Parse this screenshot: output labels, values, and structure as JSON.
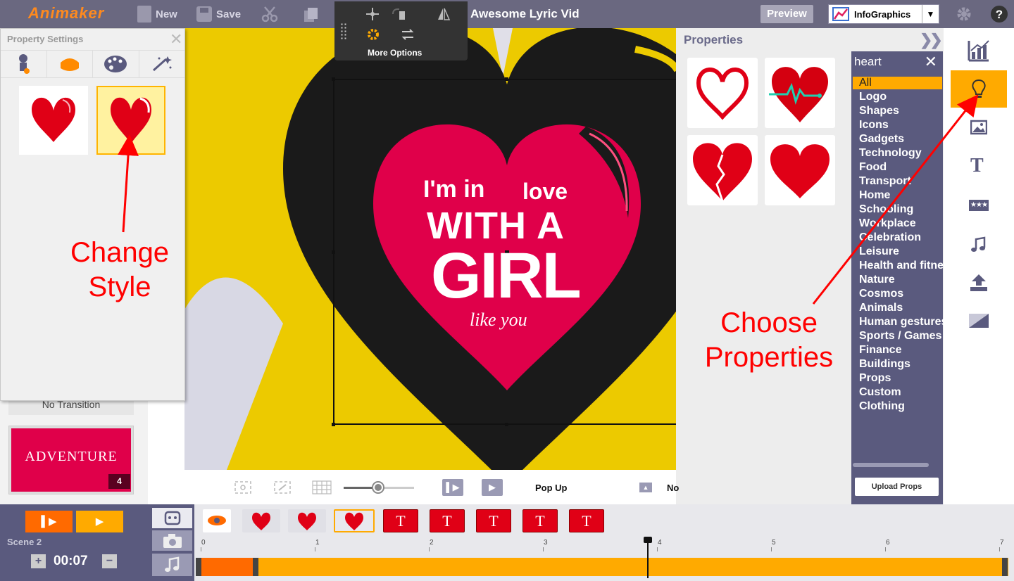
{
  "app": {
    "brand": "Animaker",
    "new_label": "New",
    "save_label": "Save",
    "project_title": "Awesome Lyric Vid",
    "preview_label": "Preview",
    "infographics_label": "InfoGraphics"
  },
  "toolbar_popup": {
    "more_options": "More Options"
  },
  "property_settings": {
    "title": "Property Settings"
  },
  "canvas": {
    "line1a": "I'm in",
    "line1b": "love",
    "line2": "WITH A",
    "line3": "GIRL",
    "line4": "like you"
  },
  "left": {
    "transition_label": "No Transition",
    "scene_thumb_text": "ADVENTURE",
    "scene_thumb_number": "4"
  },
  "properties": {
    "title": "Properties",
    "search_value": "heart",
    "upload_label": "Upload Props",
    "categories": [
      "All",
      "Logo",
      "Shapes",
      "Icons",
      "Gadgets",
      "Technology",
      "Food",
      "Transport",
      "Home",
      "Schooling",
      "Workplace",
      "Celebration",
      "Leisure",
      "Health and fitness",
      "Nature",
      "Cosmos",
      "Animals",
      "Human gestures",
      "Sports / Games",
      "Finance",
      "Buildings",
      "Props",
      "Custom",
      "Clothing"
    ]
  },
  "controls": {
    "animation_label": "Pop Up",
    "next_label": "No"
  },
  "annotations": {
    "change_style_1": "Change",
    "change_style_2": "Style",
    "choose_1": "Choose",
    "choose_2": "Properties"
  },
  "timeline": {
    "scene_label": "Scene 2",
    "duration": "00:07",
    "ticks": [
      "0",
      "1",
      "2",
      "3",
      "4",
      "5",
      "6",
      "7"
    ],
    "thumb_t": "T"
  },
  "colors": {
    "accent": "#ffaa00",
    "heart_red": "#e00016",
    "topbar": "#6a6880",
    "panel": "#5a5a7e"
  }
}
